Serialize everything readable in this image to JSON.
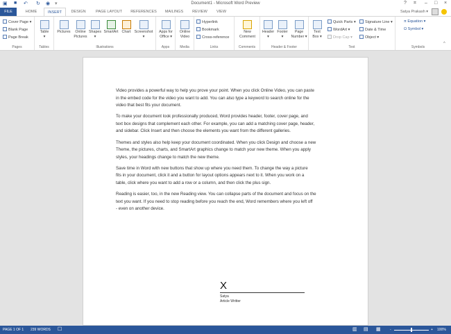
{
  "title": "Document1 - Microsoft Word Preview",
  "window_controls": {
    "help": "?",
    "restore_ribbon": "⌗",
    "minimize": "–",
    "maximize": "□",
    "close": "×"
  },
  "user": {
    "name": "Satya Prakash ▾"
  },
  "tabs": [
    "FILE",
    "HOME",
    "INSERT",
    "DESIGN",
    "PAGE LAYOUT",
    "REFERENCES",
    "MAILINGS",
    "REVIEW",
    "VIEW"
  ],
  "ribbon": {
    "pages": {
      "label": "Pages",
      "items": [
        "Cover Page ▾",
        "Blank Page",
        "Page Break"
      ]
    },
    "tables": {
      "label": "Tables",
      "table": "Table",
      "arrow": "▾"
    },
    "illustrations": {
      "label": "Illustrations",
      "pictures": "Pictures",
      "online_pictures_1": "Online",
      "online_pictures_2": "Pictures",
      "shapes": "Shapes",
      "shapes_arrow": "▾",
      "smartart": "SmartArt",
      "chart": "Chart",
      "screenshot": "Screenshot",
      "screenshot_arrow": "▾"
    },
    "apps": {
      "label": "Apps",
      "l1": "Apps for",
      "l2": "Office ▾"
    },
    "media": {
      "label": "Media",
      "l1": "Online",
      "l2": "Video"
    },
    "links": {
      "label": "Links",
      "items": [
        "Hyperlink",
        "Bookmark",
        "Cross-reference"
      ]
    },
    "comments": {
      "label": "Comments",
      "l1": "New",
      "l2": "Comment"
    },
    "header_footer": {
      "label": "Header & Footer",
      "header": "Header",
      "footer": "Footer",
      "page_number_1": "Page",
      "page_number_2": "Number ▾",
      "arrow": "▾"
    },
    "text": {
      "label": "Text",
      "textbox_1": "Text",
      "textbox_2": "Box ▾",
      "quick_parts": "Quick Parts ▾",
      "wordart": "WordArt ▾",
      "drop_cap": "Drop Cap ▾",
      "signature_line": "Signature Line ▾",
      "date_time": "Date & Time",
      "object": "Object ▾"
    },
    "symbols": {
      "label": "Symbols",
      "equation": "π Equation ▾",
      "symbol": "Ω Symbol ▾"
    },
    "collapse": "^"
  },
  "document": {
    "paragraphs": [
      [
        "Video provides a powerful way to help you prove your point. When you click Online Video, you can paste",
        "in the embed code for the video you want to add. You can also type a keyword to search online for the",
        "video that best fits your document."
      ],
      [
        "To make your document look professionally produced, Word provides header, footer, cover page, and",
        "text box designs that complement each other. For example, you can add a matching cover page, header,",
        "and sidebar. Click Insert and then choose the elements you want from the different galleries."
      ],
      [
        "Themes and styles also help keep your document coordinated. When you click Design and choose a new",
        "Theme, the pictures, charts, and SmartArt graphics change to match your new theme. When you apply",
        "styles, your headings change to match the new theme."
      ],
      [
        "Save time in Word with new buttons that show up where you need them. To change the way a picture",
        "fits in your document, click it and a button for layout options appears next to it. When you work on a",
        "table, click where you want to add a row or a column, and then click the plus sign."
      ],
      [
        "Reading is easier, too, in the new Reading view. You can collapse parts of the document and focus on the",
        "text you want. If you need to stop reading before you reach the end, Word remembers where you left off",
        "- even on another device."
      ]
    ],
    "signature": {
      "x": "X",
      "name": "Satya",
      "title": "Article Writter"
    }
  },
  "status": {
    "page": "PAGE 1 OF 1",
    "words": "239 WORDS",
    "zoom": "100%",
    "zoom_level": 100,
    "minus": "-",
    "plus": "+"
  },
  "colors": {
    "accent": "#2b579a"
  }
}
